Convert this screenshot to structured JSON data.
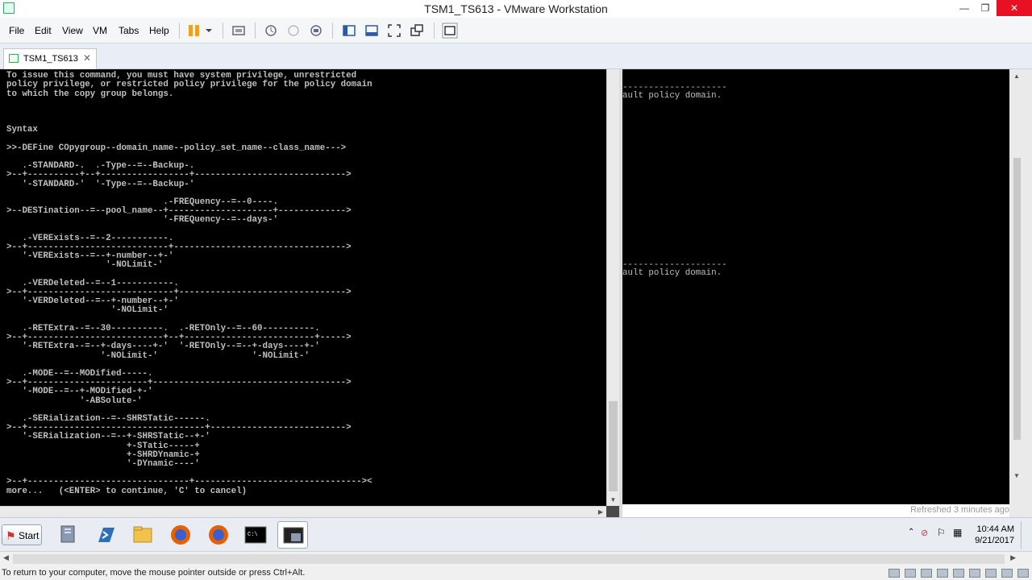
{
  "window": {
    "title": "TSM1_TS613 - VMware Workstation",
    "minimize": "—",
    "restore": "❐",
    "close": "✕"
  },
  "menu": [
    "File",
    "Edit",
    "View",
    "VM",
    "Tabs",
    "Help"
  ],
  "tab": {
    "label": "TSM1_TS613",
    "close": "✕"
  },
  "console": {
    "lines": [
      "          ",
      "To issue this command, you must have system privilege, unrestricted",
      "policy privilege, or restricted policy privilege for the policy domain",
      "to which the copy group belongs.",
      "",
      "",
      "",
      "Syntax",
      "",
      ">>-DEFine COpygroup--domain_name--policy_set_name--class_name--->",
      "",
      "   .-STANDARD-.  .-Type--=--Backup-.",
      ">--+----------+--+-----------------+----------------------------->",
      "   '-STANDARD-'  '-Type--=--Backup-'",
      "",
      "                              .-FREQuency--=--0----.",
      ">--DESTination--=--pool_name--+--------------------+------------->",
      "                              '-FREQuency--=--days-'",
      "",
      "   .-VERExists--=--2-----------.",
      ">--+---------------------------+--------------------------------->",
      "   '-VERExists--=--+-number--+-'",
      "                   '-NOLimit-'",
      "",
      "   .-VERDeleted--=--1-----------.",
      ">--+----------------------------+-------------------------------->",
      "   '-VERDeleted--=--+-number--+-'",
      "                    '-NOLimit-'",
      "",
      "   .-RETExtra--=--30----------.  .-RETOnly--=--60----------.",
      ">--+--------------------------+--+-------------------------+----->",
      "   '-RETExtra--=--+-days----+-'  '-RETOnly--=--+-days----+-'",
      "                  '-NOLimit-'                  '-NOLimit-'",
      "",
      "   .-MODE--=--MODified-----.",
      ">--+-----------------------+------------------------------------->",
      "   '-MODE--=--+-MODified-+-'",
      "              '-ABSolute-'",
      "",
      "   .-SERialization--=--SHRSTatic------.",
      ">--+----------------------------------+-------------------------->",
      "   '-SERialization--=--+-SHRSTatic--+-'",
      "                       +-STatic-----+",
      "                       +-SHRDYnamic-+",
      "                       '-DYnamic----'",
      "",
      ">--+-------------------------------+--------------------------------><",
      "more...   (<ENTER> to continue, 'C' to cancel)"
    ]
  },
  "right_pane": {
    "line1a": "--------------------",
    "line1b": "ault policy domain.",
    "line2a": "--------------------",
    "line2b": "ault policy domain.",
    "refreshed": "Refreshed 3 minutes ago"
  },
  "taskbar": {
    "start_label": "Start",
    "time": "10:44 AM",
    "date": "9/21/2017"
  },
  "status": {
    "message": "To return to your computer, move the mouse pointer outside or press Ctrl+Alt."
  },
  "colors": {
    "console_bg": "#000000",
    "console_fg": "#c0c0c0",
    "close_button": "#e81123"
  }
}
